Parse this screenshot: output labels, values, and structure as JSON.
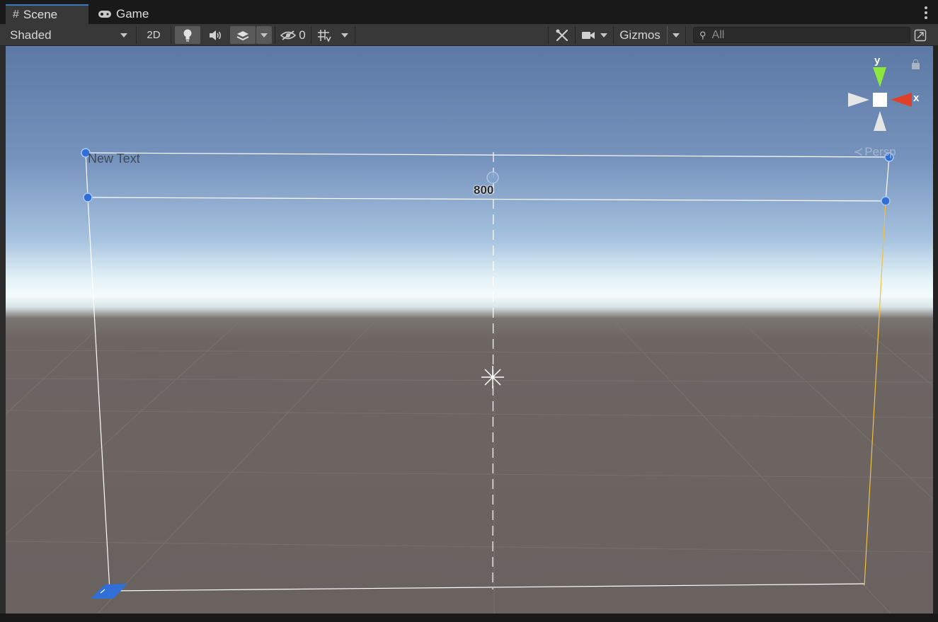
{
  "tabs": [
    {
      "label": "Scene",
      "icon": "grid-hash-icon",
      "active": true
    },
    {
      "label": "Game",
      "icon": "gamepad-icon",
      "active": false
    }
  ],
  "toolbar": {
    "shading_mode": "Shaded",
    "mode_2d": "2D",
    "lighting_icon": "lightbulb-icon",
    "audio_icon": "speaker-icon",
    "effects_icon": "layers-effects-icon",
    "hidden_count": "0",
    "hidden_icon": "eye-slash-icon",
    "grid_icon": "grid-snap-icon",
    "tools_icon": "wrench-tools-icon",
    "camera_icon": "camera-icon",
    "gizmos": "Gizmos",
    "search_placeholder": "All",
    "maximize_icon": "maximize-icon"
  },
  "scene": {
    "object_text": "New Text",
    "dimension_label": "800",
    "projection": "Persp",
    "axis_x": "x",
    "axis_y": "y"
  },
  "colors": {
    "accent_tab": "#3a79bb",
    "handle_blue": "#2f6fd6",
    "axis_x": "#e0402a",
    "axis_y": "#8ee83c",
    "frame_yellow": "#f0c040"
  }
}
